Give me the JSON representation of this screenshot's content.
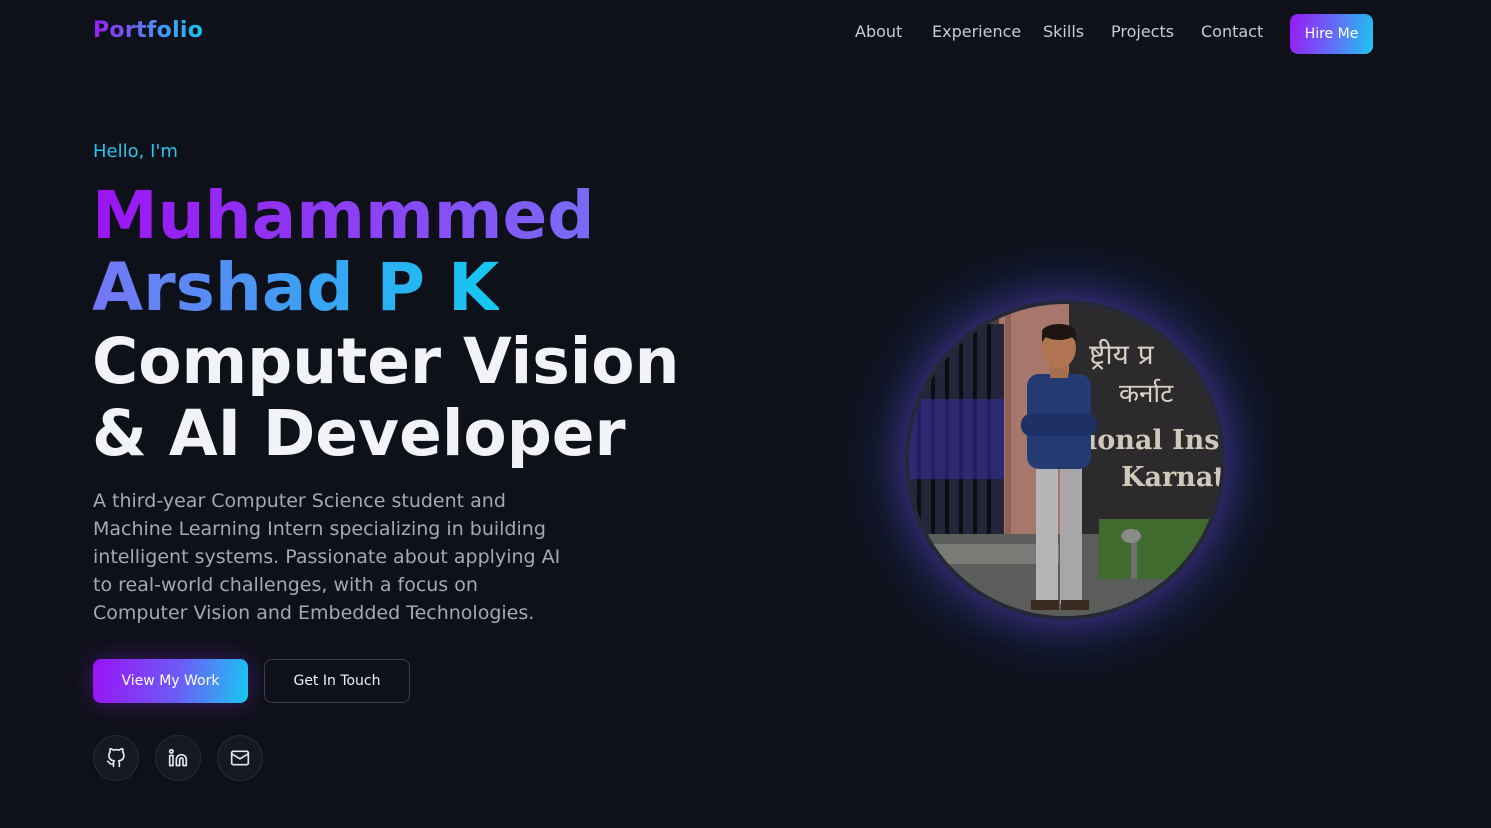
{
  "nav": {
    "logo": "Portfolio",
    "links": [
      "About",
      "Experience",
      "Skills",
      "Projects",
      "Contact"
    ],
    "cta": "Hire Me"
  },
  "hero": {
    "greeting": "Hello, I'm",
    "name_line1": "Muhammmed",
    "name_line2": "Arshad P K",
    "role_line1": "Computer Vision",
    "role_line2": "& AI Developer",
    "description": "A third-year Computer Science student and Machine Learning Intern specializing in building intelligent systems. Passionate about applying AI to real-world challenges, with a focus on Computer Vision and Embedded Technologies.",
    "primary_button": "View My Work",
    "secondary_button": "Get In Touch",
    "socials": [
      "github-icon",
      "linkedin-icon",
      "mail-icon"
    ]
  },
  "portrait": {
    "sign_line1": "ष्ट्रीय प्र",
    "sign_line2": "कर्नाट",
    "sign_line3": "ional Instit",
    "sign_line4": "Karnatal"
  },
  "colors": {
    "background": "#0f111a",
    "accent_purple": "#9a12f6",
    "accent_cyan": "#18c8f2",
    "greeting": "#22c6ef"
  }
}
